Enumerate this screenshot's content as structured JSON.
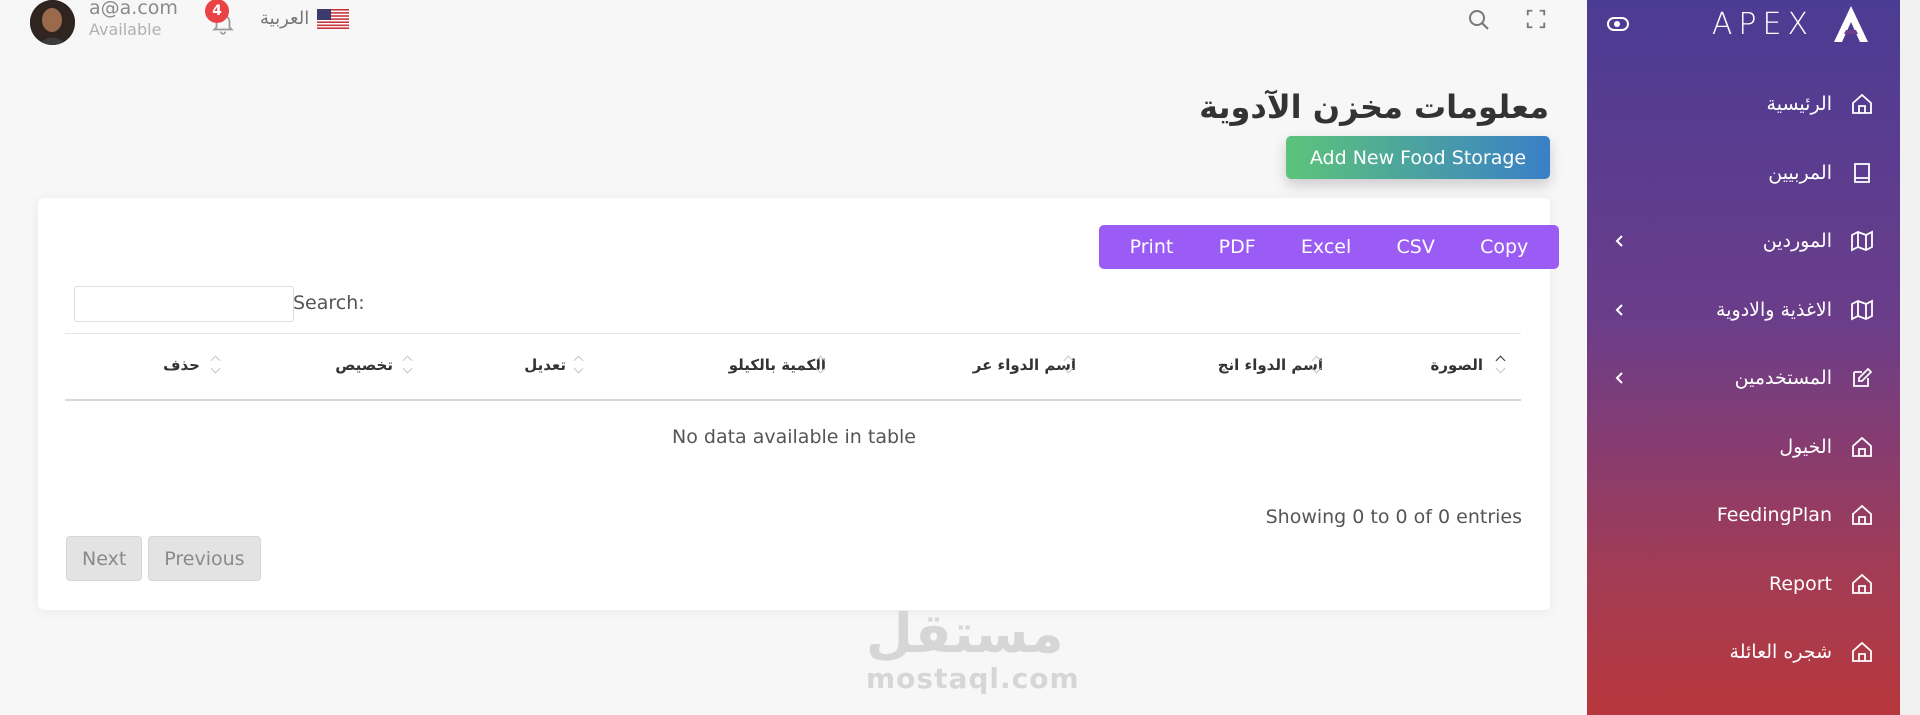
{
  "brand": {
    "name": "APEX"
  },
  "user": {
    "email": "a@a.com",
    "status": "Available"
  },
  "notifications": {
    "count": "4"
  },
  "language": {
    "label": "العربية"
  },
  "sidebar": {
    "items": [
      {
        "label": "الرئيسية",
        "icon": "home-icon"
      },
      {
        "label": "المربيين",
        "icon": "book-icon"
      },
      {
        "label": "الموردين",
        "icon": "map-icon"
      },
      {
        "label": "الاغذية والادوية",
        "icon": "map-icon"
      },
      {
        "label": "المستخدمين",
        "icon": "edit-icon"
      },
      {
        "label": "الخيول",
        "icon": "home-icon"
      },
      {
        "label": "FeedingPlan",
        "icon": "home-icon"
      },
      {
        "label": "Report",
        "icon": "home-icon"
      },
      {
        "label": "شجره العائلة",
        "icon": "home-icon"
      }
    ]
  },
  "page": {
    "title": "معلومات مخزن الآدوية",
    "add_button": "Add New Food Storage"
  },
  "table": {
    "export_buttons": [
      "Copy",
      "CSV",
      "Excel",
      "PDF",
      "Print"
    ],
    "search_label": "Search:",
    "columns": [
      "الصورة",
      "اسم الدواء انج",
      "اسم الدواء عر",
      "الكمية بالكيلو",
      "تعديل",
      "تخصيص",
      "حذف"
    ],
    "empty_message": "No data available in table",
    "info": "Showing 0 to 0 of 0 entries",
    "pager": {
      "next": "Next",
      "previous": "Previous"
    }
  },
  "watermark": {
    "arabic": "مستقل",
    "latin": "mostaql.com"
  },
  "colors": {
    "export_group": "#9a5cf5",
    "badge": "#ea4345",
    "sidebar_top": "#4b3c93",
    "sidebar_bottom": "#b8373c",
    "add_button_start": "#5cc47a",
    "add_button_end": "#3a7fc7"
  }
}
